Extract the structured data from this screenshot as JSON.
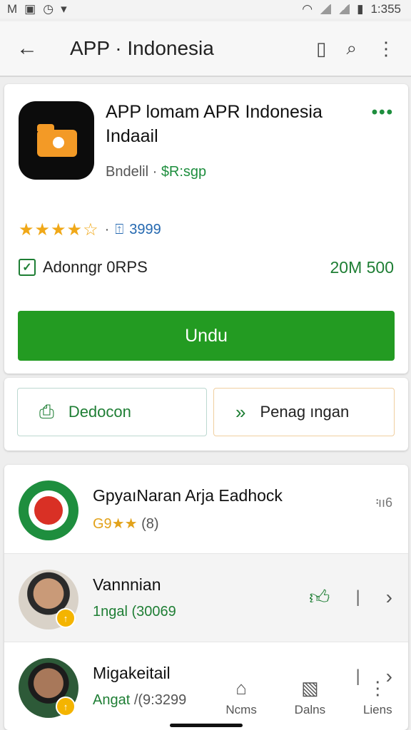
{
  "status_bar": {
    "left_text": "M",
    "time": "1:355"
  },
  "app_bar": {
    "title": "APP · Indonesia"
  },
  "app": {
    "name": "APP lomam APR Indonesia Indaail",
    "sub_plain": "Bndelil · ",
    "sub_green": "$R:sgp",
    "stars": "★★★★☆",
    "rating_sep": "·",
    "download_count": "3999",
    "checkbox_label": "Adonngr 0RPS",
    "price": "20M 500",
    "install_label": "Undu"
  },
  "secondary_buttons": [
    {
      "label": "Dedocon"
    },
    {
      "label": "Penag ıngan"
    }
  ],
  "list": {
    "developer": {
      "name": "GpyaıNaran Arja Eadhock",
      "rating": "G9★★",
      "count": " (8)",
      "corner": "᠄ıı6"
    },
    "people": [
      {
        "name": "Vannnian",
        "subtitle": "1ngal (30069"
      },
      {
        "name": "Migakeitail",
        "subtitle": "Angat",
        "subtitle_extra": " /(9:3299"
      }
    ]
  },
  "bottom_nav": [
    {
      "label": "Ncms",
      "icon": "home-icon"
    },
    {
      "label": "Dalns",
      "icon": "image-icon"
    },
    {
      "label": "Liens",
      "icon": "more-icon"
    }
  ],
  "colors": {
    "accent_green": "#239b22",
    "star_gold": "#f0a818",
    "link_blue": "#2468b0"
  }
}
